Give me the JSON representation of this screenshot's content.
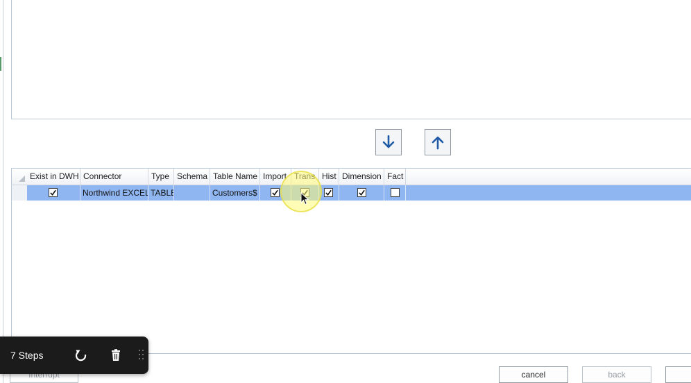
{
  "arrows": {
    "down_icon": "arrow-down-icon",
    "up_icon": "arrow-up-icon",
    "accent": "#1f5aa6"
  },
  "grid": {
    "columns": [
      "Exist in DWH",
      "Connector",
      "Type",
      "Schema",
      "Table Name",
      "Import",
      "Trans",
      "Hist",
      "Dimension",
      "Fact"
    ],
    "rows": [
      {
        "exist_in_dwh": true,
        "connector": "Northwind EXCEL",
        "type": "TABLE",
        "schema": "",
        "table_name": "Customers$",
        "import": true,
        "trans": true,
        "hist": true,
        "dimension": true,
        "fact": false
      }
    ],
    "selected_row_color": "#8fb6f0"
  },
  "steps_bar": {
    "label": "7 Steps",
    "undo_icon": "undo-icon",
    "delete_icon": "trash-icon"
  },
  "buttons": {
    "interrupt": "Interrupt",
    "cancel": "cancel",
    "back": "back"
  }
}
